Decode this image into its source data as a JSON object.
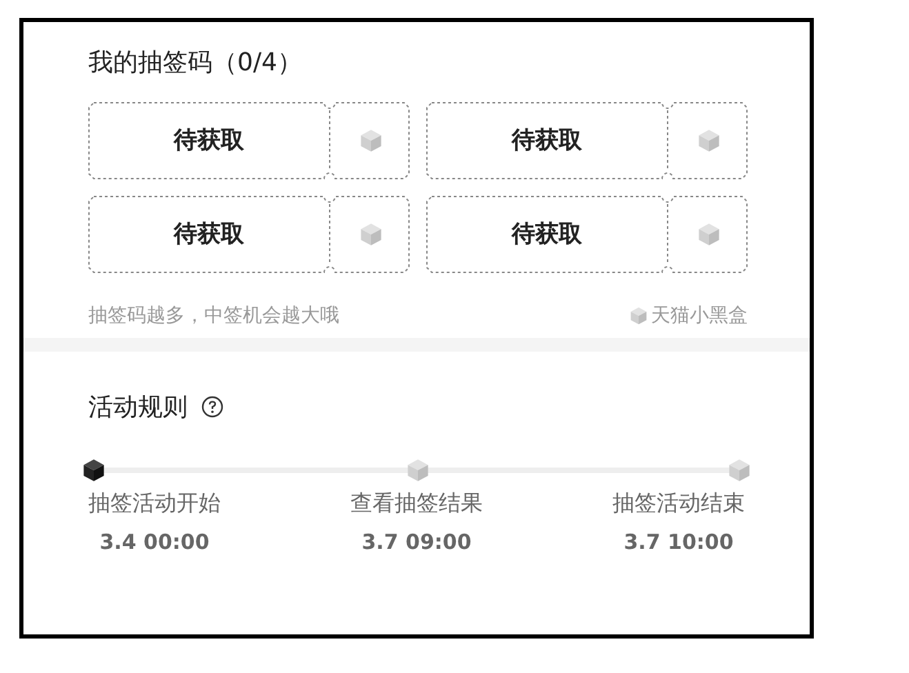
{
  "codes": {
    "title": "我的抽签码（0/4）",
    "slots": [
      {
        "status": "待获取"
      },
      {
        "status": "待获取"
      },
      {
        "status": "待获取"
      },
      {
        "status": "待获取"
      }
    ],
    "hint": "抽签码越多，中签机会越大哦",
    "brand": "天猫小黑盒"
  },
  "rules": {
    "title": "活动规则",
    "steps": [
      {
        "label": "抽签活动开始",
        "time": "3.4 00:00",
        "reached": true
      },
      {
        "label": "查看抽签结果",
        "time": "3.7 09:00",
        "reached": false
      },
      {
        "label": "抽签活动结束",
        "time": "3.7 10:00",
        "reached": false
      }
    ]
  }
}
